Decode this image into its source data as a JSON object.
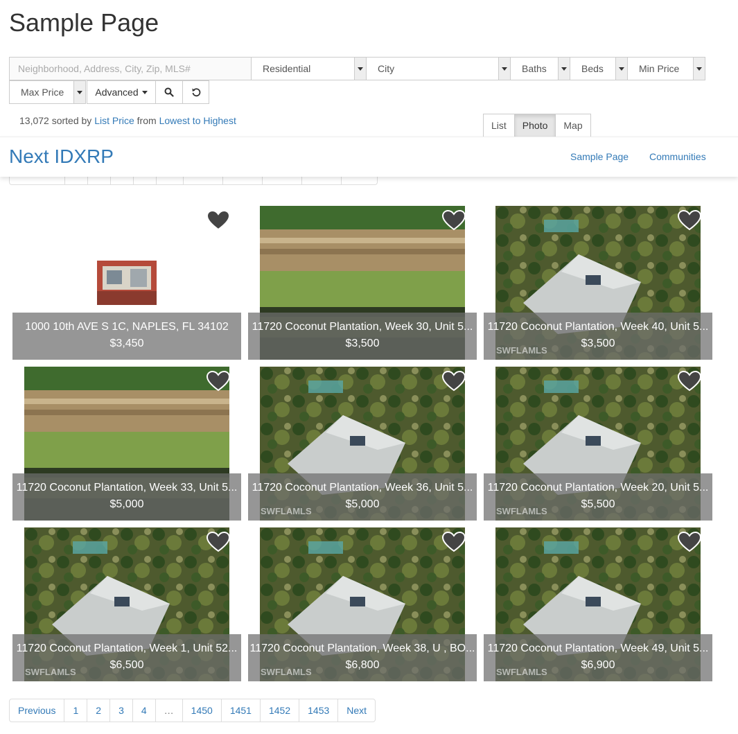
{
  "page_title": "Sample Page",
  "search": {
    "location_placeholder": "Neighborhood, Address, City, Zip, MLS#",
    "property_type": "Residential",
    "city": "City",
    "baths": "Baths",
    "beds": "Beds",
    "min_price": "Min Price",
    "max_price": "Max Price",
    "advanced_label": "Advanced",
    "search_icon": "search-icon",
    "reset_icon": "reset-icon"
  },
  "results": {
    "count": "13,072",
    "sorted_by_text": "sorted by",
    "sort_field": "List Price",
    "from_text": "from",
    "sort_order": "Lowest to Highest"
  },
  "views": [
    "List",
    "Photo",
    "Map"
  ],
  "active_view": "Photo",
  "navbar": {
    "brand": "Next IDXRP",
    "links": [
      "Sample Page",
      "Communities"
    ]
  },
  "listings": [
    {
      "address": "1000 10th AVE S 1C, NAPLES, FL 34102",
      "price": "$3,450",
      "photo": "house-thumb",
      "watermark": ""
    },
    {
      "address": "11720 Coconut Plantation, Week 30, Unit 5...",
      "price": "$3,500",
      "photo": "waterfall",
      "watermark": ""
    },
    {
      "address": "11720 Coconut Plantation, Week 40, Unit 5...",
      "price": "$3,500",
      "photo": "aerial",
      "watermark": "SWFLAMLS"
    },
    {
      "address": "11720 Coconut Plantation, Week 33, Unit 5...",
      "price": "$5,000",
      "photo": "waterfall",
      "watermark": ""
    },
    {
      "address": "11720 Coconut Plantation, Week 36, Unit 5...",
      "price": "$5,000",
      "photo": "aerial",
      "watermark": "SWFLAMLS"
    },
    {
      "address": "11720 Coconut Plantation, Week 20, Unit 5...",
      "price": "$5,500",
      "photo": "aerial",
      "watermark": "SWFLAMLS"
    },
    {
      "address": "11720 Coconut Plantation, Week 1, Unit 52...",
      "price": "$6,500",
      "photo": "aerial",
      "watermark": "SWFLAMLS"
    },
    {
      "address": "11720 Coconut Plantation, Week 38, U , BO...",
      "price": "$6,800",
      "photo": "aerial",
      "watermark": "SWFLAMLS"
    },
    {
      "address": "11720 Coconut Plantation, Week 49, Unit 5...",
      "price": "$6,900",
      "photo": "aerial",
      "watermark": "SWFLAMLS"
    }
  ],
  "pagination": [
    "Previous",
    "1",
    "2",
    "3",
    "4",
    "…",
    "1450",
    "1451",
    "1452",
    "1453",
    "Next"
  ],
  "colors": {
    "link": "#337ab7",
    "caption_bg": "#6e6e6e",
    "active_view_bg": "#e6e6e6"
  }
}
